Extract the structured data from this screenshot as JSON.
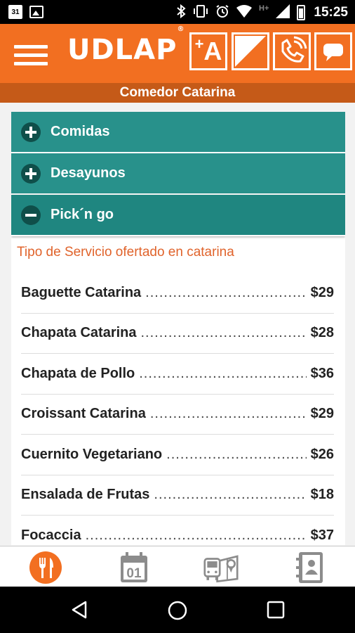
{
  "statusbar": {
    "calendar_day": "31",
    "network": "H+",
    "time": "15:25"
  },
  "header": {
    "logo": "UDLAP",
    "logo_mark": "®",
    "plus_a_button": "A"
  },
  "subheader": {
    "title": "Comedor Catarina"
  },
  "accordion": [
    {
      "label": "Comidas",
      "state": "collapsed"
    },
    {
      "label": "Desayunos",
      "state": "collapsed"
    },
    {
      "label": "Pick´n go",
      "state": "expanded"
    }
  ],
  "section": {
    "service_title": "Tipo de Servicio ofertado en catarina",
    "items": [
      {
        "name": "Baguette Catarina",
        "price": "$29"
      },
      {
        "name": "Chapata Catarina",
        "price": "$28"
      },
      {
        "name": "Chapata de Pollo",
        "price": "$36"
      },
      {
        "name": "Croissant Catarina",
        "price": "$29"
      },
      {
        "name": "Cuernito Vegetariano",
        "price": "$26"
      },
      {
        "name": "Ensalada de Frutas",
        "price": "$18"
      },
      {
        "name": "Focaccia",
        "price": "$37"
      }
    ]
  },
  "tabbar": {
    "tabs": [
      {
        "icon": "fork-knife-icon",
        "active": true
      },
      {
        "icon": "calendar-icon",
        "label": "01",
        "active": false
      },
      {
        "icon": "bus-map-icon",
        "active": false
      },
      {
        "icon": "contacts-icon",
        "active": false
      }
    ]
  },
  "colors": {
    "brand_orange": "#f26f21",
    "subheader_orange": "#c55a18",
    "teal": "#28918b",
    "accent_text": "#e0632b"
  }
}
